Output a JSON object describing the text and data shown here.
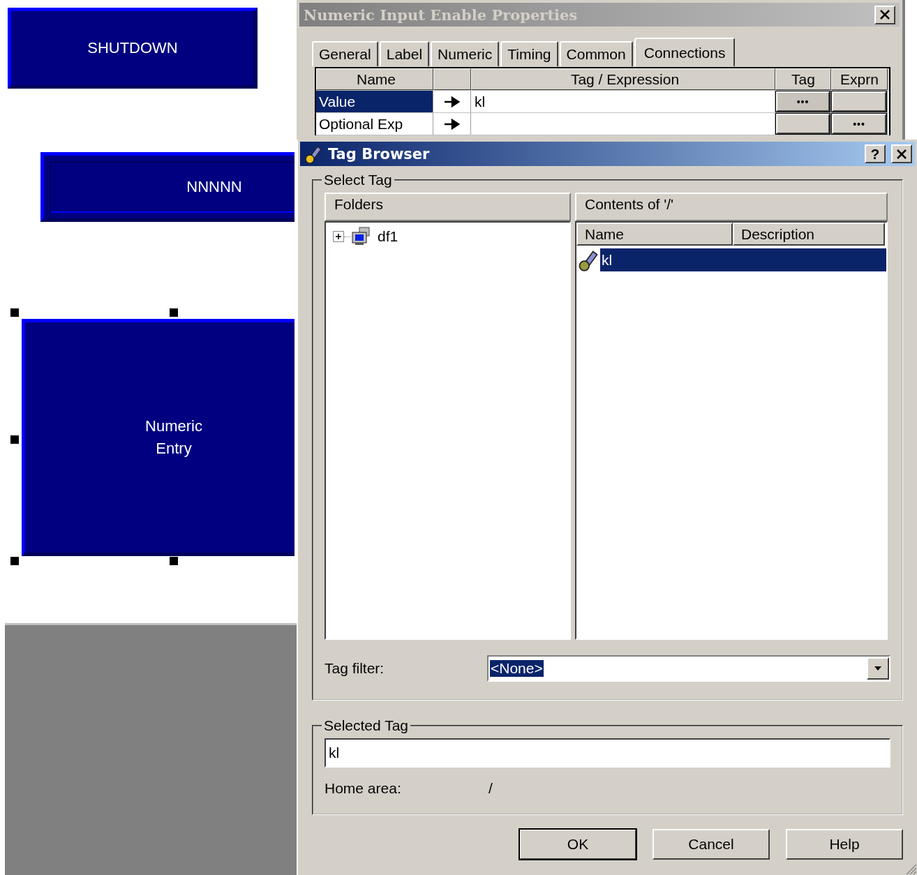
{
  "canvas": {
    "objects": [
      {
        "kind": "button",
        "label": "SHUTDOWN",
        "selected": false
      },
      {
        "kind": "display",
        "label": "NNNNN",
        "selected": false
      },
      {
        "kind": "button",
        "label": "Numeric\nEntry",
        "selected": true
      }
    ]
  },
  "properties_window": {
    "title": "Numeric Input Enable Properties",
    "tabs": [
      {
        "label": "General",
        "selected": false
      },
      {
        "label": "Label",
        "selected": false
      },
      {
        "label": "Numeric",
        "selected": false
      },
      {
        "label": "Timing",
        "selected": false
      },
      {
        "label": "Common",
        "selected": false
      },
      {
        "label": "Connections",
        "selected": true
      }
    ],
    "columns": [
      "Name",
      "",
      "Tag / Expression",
      "Tag",
      "Exprn"
    ],
    "rows": [
      {
        "name": "Value",
        "value": "kl",
        "selected": true,
        "tag_button": "•••"
      },
      {
        "name": "Optional Exp",
        "value": "",
        "selected": false,
        "exprn_button": "•••"
      }
    ]
  },
  "tag_browser": {
    "title": "Tag Browser",
    "help_label": "?",
    "select_group": "Select Tag",
    "folders": {
      "header": "Folders",
      "tree": [
        {
          "label": "df1",
          "expanded": false
        }
      ]
    },
    "contents": {
      "header": "Contents of '/'",
      "columns": [
        "Name",
        "Description"
      ],
      "rows": [
        {
          "name": "kl",
          "selected": true
        }
      ]
    },
    "tag_filter": {
      "label": "Tag filter:",
      "value": "<None>",
      "highlighted": true
    },
    "selected_group": "Selected Tag",
    "selected_tag": "kl",
    "home_area": {
      "label": "Home area:",
      "value": "/"
    },
    "buttons": [
      {
        "label": "OK",
        "default": true
      },
      {
        "label": "Cancel",
        "default": false
      },
      {
        "label": "Help",
        "default": false
      }
    ]
  }
}
